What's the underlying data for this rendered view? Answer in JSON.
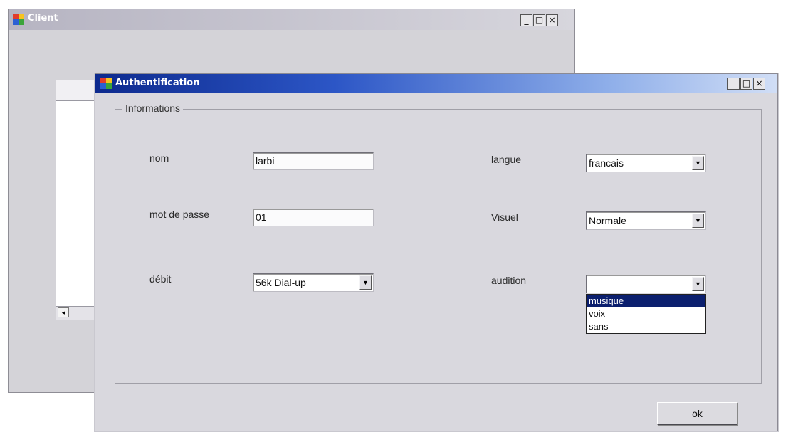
{
  "client_window": {
    "title": "Client",
    "controls": {
      "minimize": "_",
      "maximize": "□",
      "close": "×"
    },
    "list_scroll_left": "◂"
  },
  "auth_dialog": {
    "title": "Authentification",
    "controls": {
      "minimize": "_",
      "maximize": "□",
      "close": "×"
    },
    "group_label": "Informations",
    "fields": {
      "nom": {
        "label": "nom",
        "value": "larbi"
      },
      "mot_de_passe": {
        "label": "mot de passe",
        "value": "01"
      },
      "debit": {
        "label": "débit",
        "value": "56k Dial-up"
      },
      "langue": {
        "label": "langue",
        "value": "francais"
      },
      "visuel": {
        "label": "Visuel",
        "value": "Normale"
      },
      "audition": {
        "label": "audition",
        "value": "",
        "options": [
          "musique",
          "voix",
          "sans"
        ],
        "highlighted": "musique"
      }
    },
    "dropdown_arrow": "▼",
    "ok_button": "ok"
  },
  "colors": {
    "active_titlebar": "#0d2a8e",
    "inactive_titlebar": "#b6b4c2",
    "selection": "#0b1f6e",
    "window_bg": "#d9d8de"
  }
}
